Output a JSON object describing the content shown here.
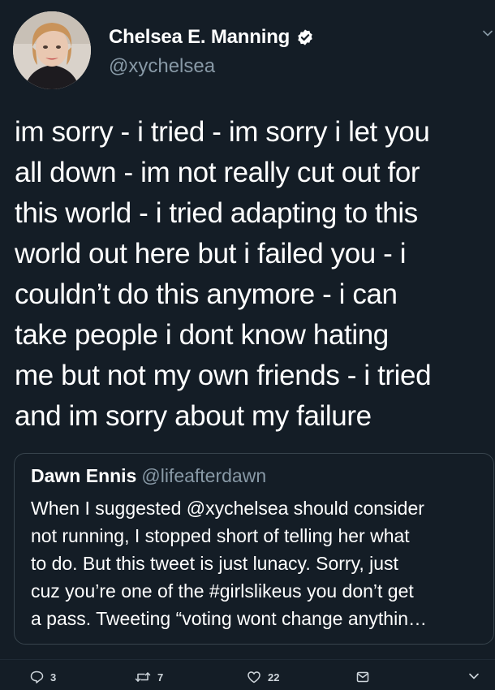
{
  "author": {
    "name": "Chelsea E. Manning",
    "handle": "@xychelsea",
    "verified": true
  },
  "tweet": {
    "text": "im sorry - i tried - im sorry i let you\nall down - im not really cut out for\nthis world - i tried adapting to this\nworld out here but i failed you - i\ncouldn’t do this anymore - i can\ntake people i dont know hating\nme but not my own friends - i tried\nand im sorry about my failure"
  },
  "quoted_tweet": {
    "name": "Dawn Ennis",
    "handle": "@lifeafterdawn",
    "text": "When I suggested @xychelsea should consider\nnot running, I stopped short of telling her what\nto do. But this tweet is just lunacy. Sorry, just\ncuz you’re one of the #girlslikeus you don’t get\na pass. Tweeting “voting wont change anythin…"
  },
  "actions": {
    "reply_count": "3",
    "retweet_count": "7",
    "like_count": "22"
  },
  "colors": {
    "background": "#141d26",
    "text": "#ffffff",
    "secondary": "#8899a6",
    "border": "#38444d",
    "verified_badge": "#ffffff"
  },
  "icons": [
    "more-chevron-icon",
    "verified-icon",
    "reply-icon",
    "retweet-icon",
    "like-icon",
    "direct-message-icon",
    "share-chevron-icon"
  ]
}
